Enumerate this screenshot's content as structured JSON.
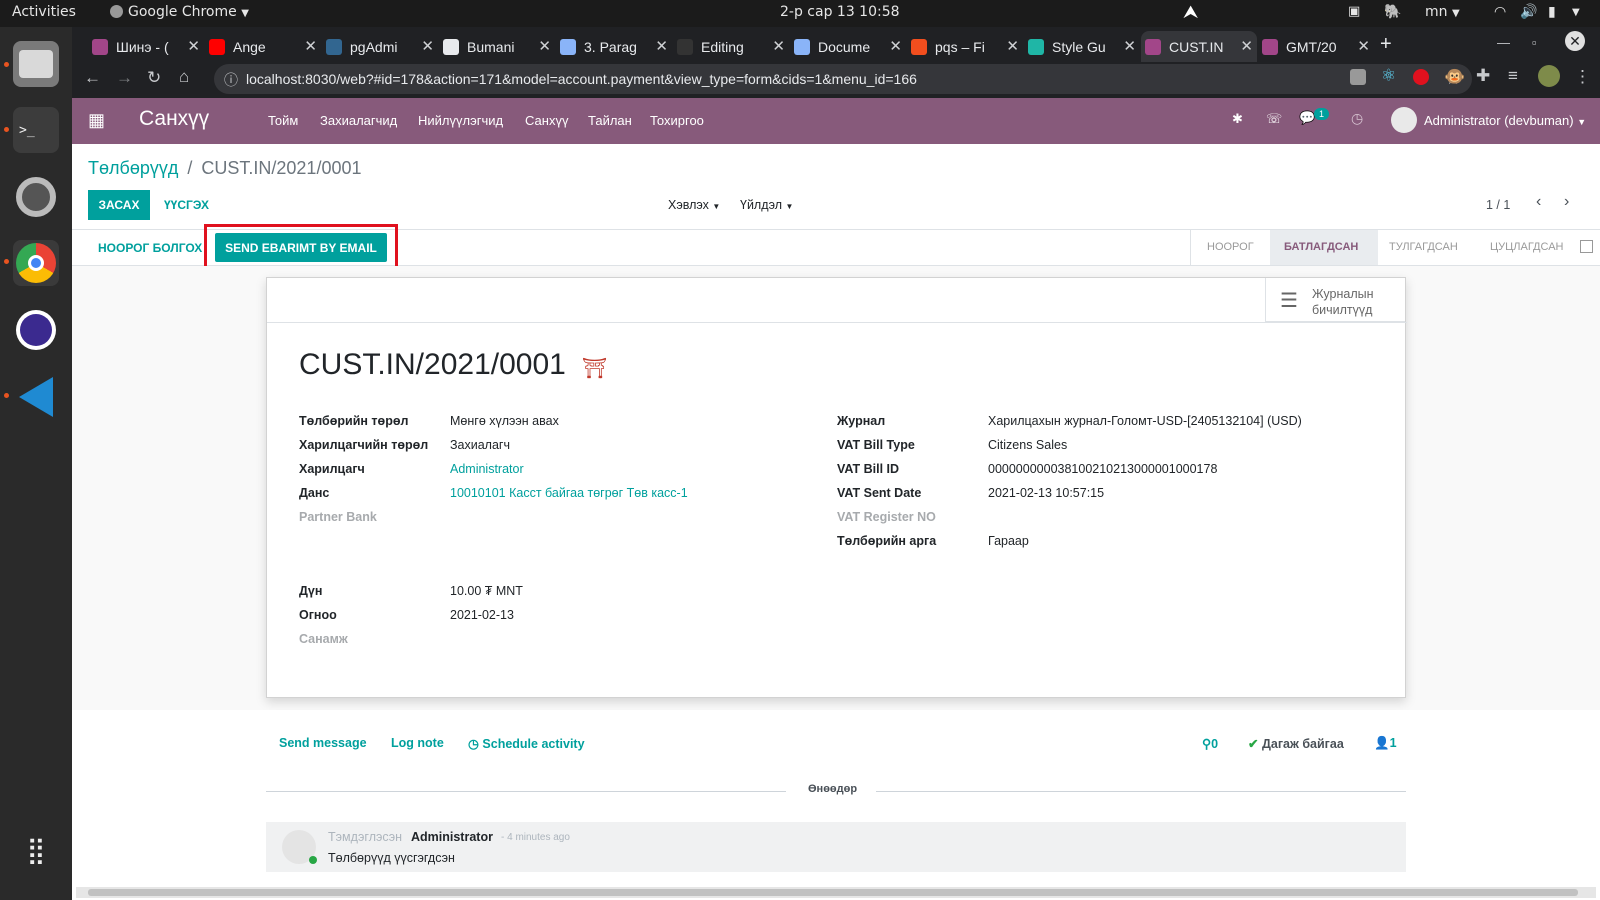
{
  "system_bar": {
    "activities": "Activities",
    "app_menu": "Google Chrome",
    "clock": "2-р сар 13  10:58",
    "lang": "mn"
  },
  "tabs": [
    {
      "label": "Шинэ - (",
      "icon": "odoo-icon",
      "color": "#a24689"
    },
    {
      "label": "Ange",
      "icon": "youtube-icon",
      "color": "#ff0000"
    },
    {
      "label": "pgAdmi",
      "icon": "pgadmin-icon",
      "color": "#326690"
    },
    {
      "label": "Bumani",
      "icon": "globe-icon",
      "color": "#e8eaed"
    },
    {
      "label": "3. Parag",
      "icon": "document-icon",
      "color": "#8ab4f8"
    },
    {
      "label": "Editing",
      "icon": "github-icon",
      "color": "#333333"
    },
    {
      "label": "Docume",
      "icon": "document-icon",
      "color": "#8ab4f8"
    },
    {
      "label": "pqs – Fi",
      "icon": "figma-icon",
      "color": "#f24e1e"
    },
    {
      "label": "Style Gu",
      "icon": "style-icon",
      "color": "#1fb6a6"
    },
    {
      "label": "CUST.IN",
      "icon": "odoo-icon",
      "color": "#a24689",
      "active": true
    },
    {
      "label": "GMT/20",
      "icon": "odoo-icon",
      "color": "#a24689"
    }
  ],
  "url": "localhost:8030/web?#id=178&action=171&model=account.payment&view_type=form&cids=1&menu_id=166",
  "app": {
    "name": "Санхүү",
    "menus": [
      "Тойм",
      "Захиалагчид",
      "Нийлүүлэгчид",
      "Санхүү",
      "Тайлан",
      "Тохиргоо"
    ],
    "chat_count": "1",
    "user": "Administrator (devbuman)"
  },
  "breadcrumb": {
    "parent": "Төлбөрүүд",
    "sep": "/",
    "current": "CUST.IN/2021/0001"
  },
  "buttons": {
    "edit": "ЗАСАХ",
    "create": "ҮҮСГЭХ",
    "print": "Хэвлэх",
    "action": "Үйлдэл",
    "draft": "НООРОГ БОЛГОХ",
    "send_ebarimt": "SEND EBARIMT BY EMAIL"
  },
  "pager": "1 / 1",
  "status_steps": [
    "НООРОГ",
    "БАТЛАГДСАН",
    "ТУЛГАГДСАН",
    "ЦУЦЛАГДСАН"
  ],
  "status_active": "БАТЛАГДСАН",
  "journal_items": {
    "line1": "Журналын",
    "line2": "бичилтүүд"
  },
  "record_title": "CUST.IN/2021/0001",
  "left_fields": [
    {
      "label": "Төлбөрийн төрөл",
      "value": "Мөнгө хүлээн авах"
    },
    {
      "label": "Харилцагчийн төрөл",
      "value": "Захиалагч"
    },
    {
      "label": "Харилцагч",
      "value": "Administrator",
      "link": true
    },
    {
      "label": "Данс",
      "value": "10010101 Касст байгаа төгрөг Төв касс-1",
      "link": true
    },
    {
      "label": "Partner Bank",
      "value": "",
      "muted": true
    }
  ],
  "left_fields2": [
    {
      "label": "Дүн",
      "value": "10.00 ₮ MNT"
    },
    {
      "label": "Огноо",
      "value": "2021-02-13"
    },
    {
      "label": "Санамж",
      "value": "",
      "muted": true
    }
  ],
  "right_fields": [
    {
      "label": "Журнал",
      "value": "Харилцахын журнал-Голомт-USD-[2405132104] (USD)"
    },
    {
      "label": "VAT Bill Type",
      "value": "Citizens Sales"
    },
    {
      "label": "VAT Bill ID",
      "value": "000000000038100210213000001000178"
    },
    {
      "label": "VAT Sent Date",
      "value": "2021-02-13 10:57:15"
    },
    {
      "label": "VAT Register NO",
      "value": "",
      "muted": true
    },
    {
      "label": "Төлбөрийн арга",
      "value": "Гараар"
    }
  ],
  "chatter": {
    "send_message": "Send message",
    "log_note": "Log note",
    "schedule": "Schedule activity",
    "attachments": "0",
    "following": "Дагаж байгаа",
    "followers": "1",
    "date_sep": "Өнөөдөр",
    "msg_prefix": "Тэмдэглэсэн",
    "msg_author": "Administrator",
    "msg_time": "- 4 minutes ago",
    "msg_body": "Төлбөрүүд үүсгэгдсэн"
  },
  "colors": {
    "brand": "#875a7b",
    "primary": "#00a09d",
    "highlight": "#e0111e"
  }
}
